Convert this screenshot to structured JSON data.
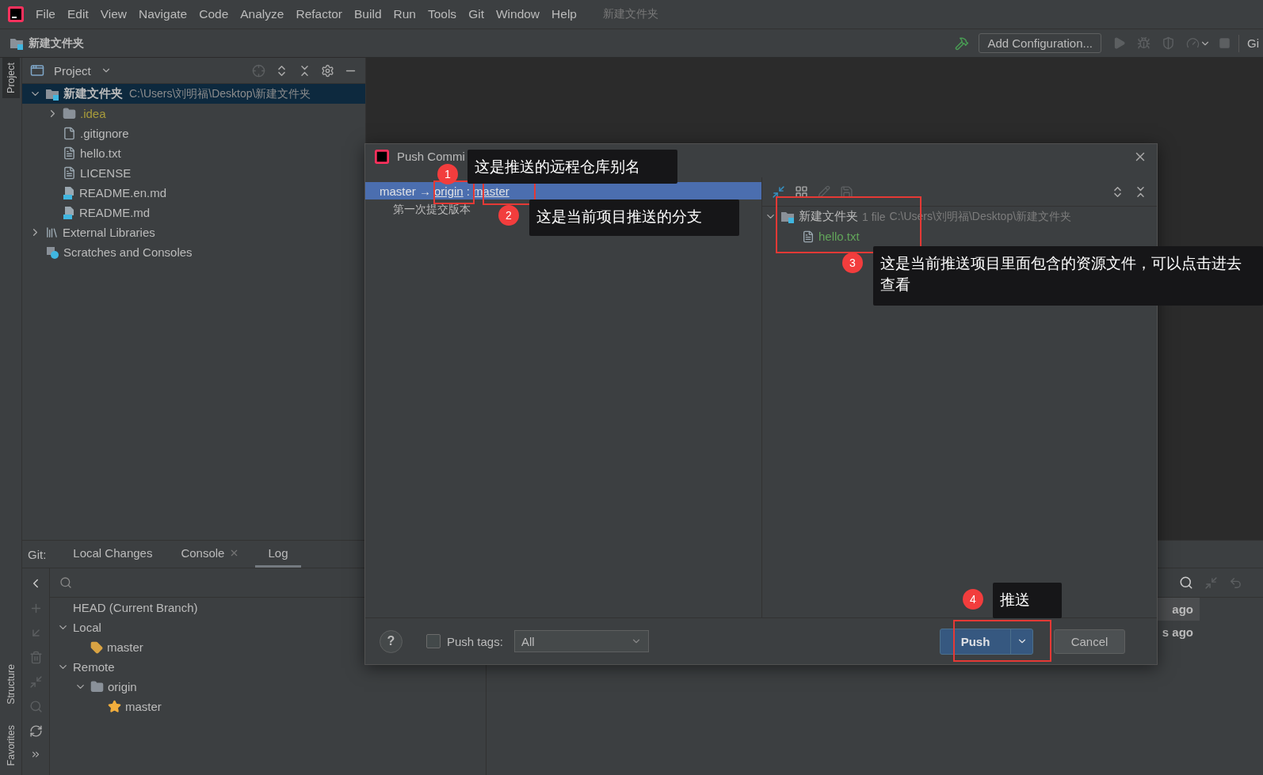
{
  "menu": [
    "File",
    "Edit",
    "View",
    "Navigate",
    "Code",
    "Analyze",
    "Refactor",
    "Build",
    "Run",
    "Tools",
    "Git",
    "Window",
    "Help"
  ],
  "window_title": "新建文件夹",
  "navbar": {
    "breadcrumb": "新建文件夹",
    "run_config": "Add Configuration...",
    "cut_label": "Gi"
  },
  "side_tabs": [
    {
      "label": "Project",
      "selected": true,
      "kind": "top"
    },
    {
      "label": "Structure",
      "selected": false,
      "kind": "bottom"
    },
    {
      "label": "Favorites",
      "selected": false,
      "kind": "bottom"
    }
  ],
  "project_panel": {
    "title": "Project",
    "tree": [
      {
        "label": "新建文件夹",
        "path": "C:\\Users\\刘明福\\Desktop\\新建文件夹",
        "kind": "module",
        "expanded": true,
        "selected": true,
        "children": [
          {
            "label": ".idea",
            "kind": "folder",
            "expanded": false,
            "selected": false,
            "ignored": true
          },
          {
            "label": ".gitignore",
            "kind": "ignore-file",
            "selected": false,
            "ignored": false
          },
          {
            "label": "hello.txt",
            "kind": "file",
            "selected": false,
            "ignored": false
          },
          {
            "label": "LICENSE",
            "kind": "file",
            "selected": false,
            "ignored": false
          },
          {
            "label": "README.en.md",
            "kind": "markdown",
            "selected": false,
            "ignored": false
          },
          {
            "label": "README.md",
            "kind": "markdown",
            "selected": false,
            "ignored": false
          }
        ]
      },
      {
        "label": "External Libraries",
        "kind": "library",
        "expanded": false,
        "selected": false
      },
      {
        "label": "Scratches and Consoles",
        "kind": "scratches",
        "selected": false
      }
    ]
  },
  "git_panel": {
    "label": "Git:",
    "tabs": [
      {
        "label": "Local Changes",
        "selected": false,
        "closable": false
      },
      {
        "label": "Console",
        "selected": false,
        "closable": true
      },
      {
        "label": "Log",
        "selected": true,
        "closable": false
      }
    ],
    "branches": [
      {
        "label": "HEAD (Current Branch)",
        "kind": "head"
      },
      {
        "label": "Local",
        "kind": "group",
        "expanded": true,
        "children": [
          {
            "label": "master",
            "kind": "local-branch"
          }
        ]
      },
      {
        "label": "Remote",
        "kind": "group",
        "expanded": true,
        "children": [
          {
            "label": "origin",
            "kind": "remote-folder",
            "expanded": true,
            "children": [
              {
                "label": "master",
                "kind": "remote-branch"
              }
            ]
          }
        ]
      }
    ],
    "log_dates": [
      "ago",
      "s ago"
    ]
  },
  "dialog": {
    "title": "Push Commi",
    "push_row": {
      "source": "master →",
      "remote": "origin",
      "separator": ":",
      "branch": "master",
      "selected": true
    },
    "commits": [
      "第一次提交版本"
    ],
    "changes": {
      "folder": "新建文件夹",
      "count": "1 file",
      "path": "C:\\Users\\刘明福\\Desktop\\新建文件夹",
      "expanded": true,
      "files": [
        "hello.txt"
      ]
    },
    "help": "?",
    "push_tags": {
      "label": "Push tags:",
      "checked": false,
      "value": "All"
    },
    "push_button": "Push",
    "cancel_button": "Cancel"
  },
  "annotations": [
    {
      "number": "1",
      "text": "这是推送的远程仓库别名"
    },
    {
      "number": "2",
      "text": "这是当前项目推送的分支"
    },
    {
      "number": "3",
      "text": "这是当前推送项目里面包含的资源文件，可以点击进去查看"
    },
    {
      "number": "4",
      "text": "推送"
    }
  ]
}
